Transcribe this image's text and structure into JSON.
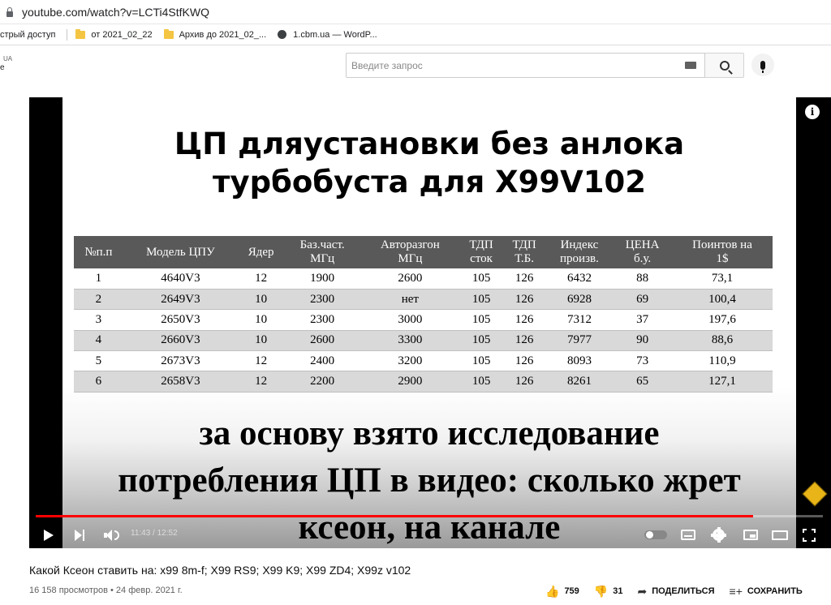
{
  "browser": {
    "url": "youtube.com/watch?v=LCTi4StfKWQ",
    "bookmarks": [
      {
        "label": "стрый доступ",
        "icon": "apps-icon"
      },
      {
        "label": "от 2021_02_22",
        "icon": "folder-icon"
      },
      {
        "label": "Архив до 2021_02_...",
        "icon": "folder-icon"
      },
      {
        "label": "1.cbm.ua — WordP...",
        "icon": "globe-icon"
      }
    ]
  },
  "header": {
    "logo_region": "UA",
    "logo_fragment": "e",
    "search_placeholder": "Введите запрос"
  },
  "slide": {
    "title_line1": "ЦП дляустановки без анлока",
    "title_line2": "турбобуста для X99V102",
    "table": {
      "columns": [
        [
          "№п.п"
        ],
        [
          "Модель ЦПУ"
        ],
        [
          "Ядер"
        ],
        [
          "Баз.част.",
          "МГц"
        ],
        [
          "Авторазгон",
          "МГц"
        ],
        [
          "ТДП",
          "сток"
        ],
        [
          "ТДП",
          "Т.Б."
        ],
        [
          "Индекс",
          "произв."
        ],
        [
          "ЦЕНА",
          "б.у."
        ],
        [
          "Поинтов на",
          "1$"
        ]
      ],
      "rows": [
        [
          "1",
          "4640V3",
          "12",
          "1900",
          "2600",
          "105",
          "126",
          "6432",
          "88",
          "73,1"
        ],
        [
          "2",
          "2649V3",
          "10",
          "2300",
          "нет",
          "105",
          "126",
          "6928",
          "69",
          "100,4"
        ],
        [
          "3",
          "2650V3",
          "10",
          "2300",
          "3000",
          "105",
          "126",
          "7312",
          "37",
          "197,6"
        ],
        [
          "4",
          "2660V3",
          "10",
          "2600",
          "3300",
          "105",
          "126",
          "7977",
          "90",
          "88,6"
        ],
        [
          "5",
          "2673V3",
          "12",
          "2400",
          "3200",
          "105",
          "126",
          "8093",
          "73",
          "110,9"
        ],
        [
          "6",
          "2658V3",
          "12",
          "2200",
          "2900",
          "105",
          "126",
          "8261",
          "65",
          "127,1"
        ]
      ]
    },
    "caption_line1": "за основу взято исследование",
    "caption_line2": "потребления ЦП в видео: сколько жрет",
    "caption_line3": "ксеон, на канале"
  },
  "player": {
    "time": "11:43 / 12:52",
    "progress": 0.911,
    "info_glyph": "i",
    "accent": "#ff0000"
  },
  "video": {
    "title": "Какой Ксеон ставить на: x99 8m-f; X99 RS9; X99 K9; X99 ZD4; X99z v102",
    "views": "16 158 просмотров • 24 февр. 2021 г.",
    "likes": "759",
    "dislikes": "31",
    "share_label": "ПОДЕЛИТЬСЯ",
    "save_label": "СОХРАНИТЬ"
  }
}
